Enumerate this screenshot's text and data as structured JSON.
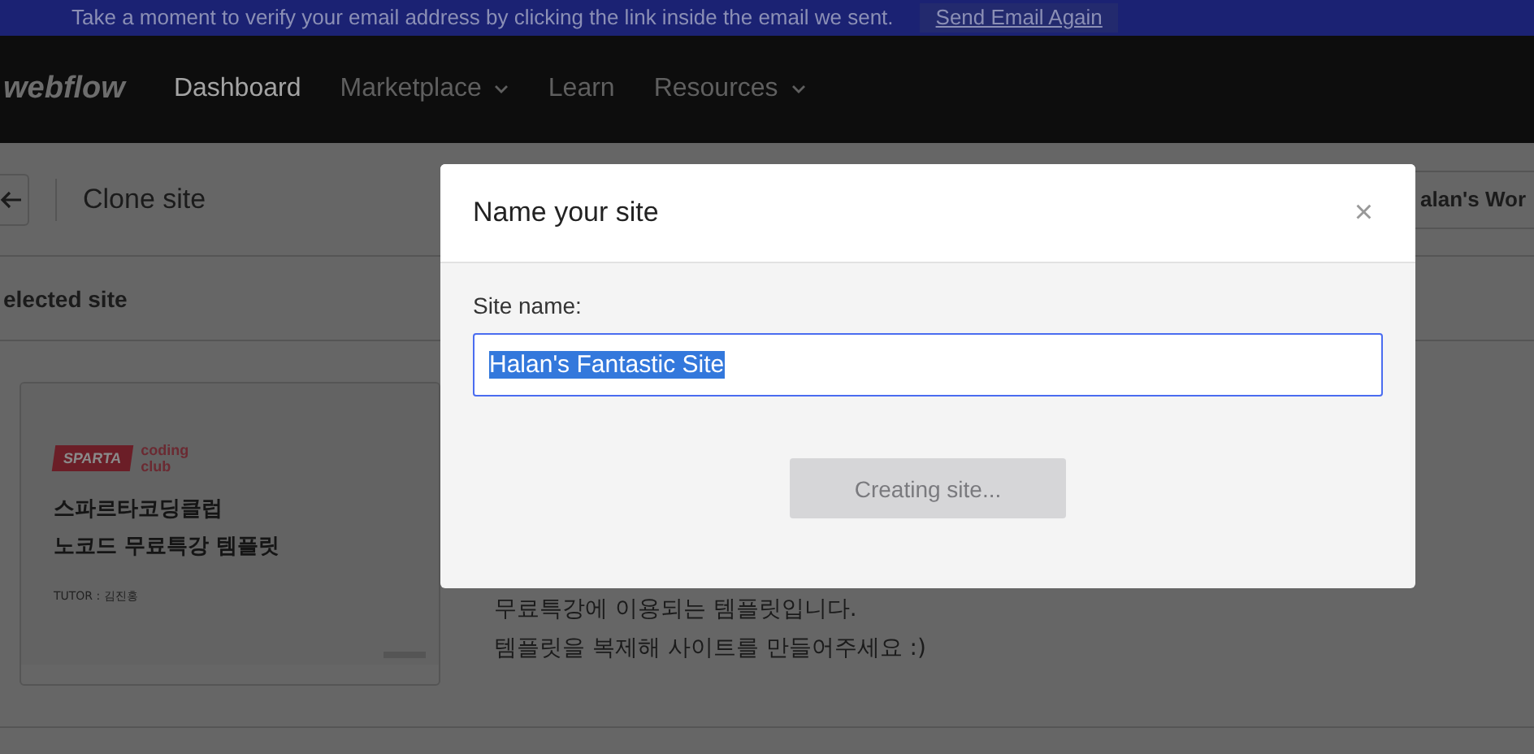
{
  "banner": {
    "message": "Take a moment to verify your email address by clicking the link inside the email we sent.",
    "button": "Send Email Again"
  },
  "nav": {
    "logo": "webflow",
    "items": [
      {
        "label": "Dashboard",
        "selected": true,
        "dropdown": false
      },
      {
        "label": "Marketplace",
        "selected": false,
        "dropdown": true
      },
      {
        "label": "Learn",
        "selected": false,
        "dropdown": false
      },
      {
        "label": "Resources",
        "selected": false,
        "dropdown": true
      }
    ]
  },
  "header": {
    "title": "Clone site",
    "workspace": "alan's Wor"
  },
  "section": {
    "title": "elected site"
  },
  "template": {
    "logo_word": "SPARTA",
    "logo_side": "coding club",
    "heading_lines": [
      "스파르타코딩클럽",
      "노코드 무료특강 템플릿"
    ],
    "tutor": "TUTOR : 김진홍",
    "description_lines": [
      "무료특강에 이용되는 템플릿입니다.",
      "템플릿을 복제해 사이트를 만들어주세요 :)"
    ]
  },
  "modal": {
    "title": "Name your site",
    "close": "×",
    "label": "Site name:",
    "value": "Halan's Fantastic Site",
    "text_selected": true,
    "button": {
      "label": "Creating site...",
      "disabled": true
    }
  }
}
